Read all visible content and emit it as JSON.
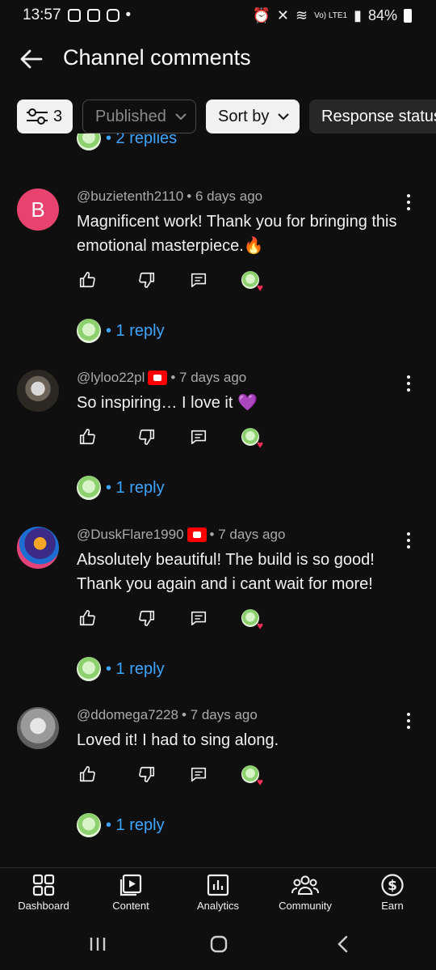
{
  "status_bar": {
    "time": "13:57",
    "signal": "Vo) LTE1",
    "battery": "84%"
  },
  "header": {
    "title": "Channel comments"
  },
  "filters": {
    "filter_count": "3",
    "published": "Published",
    "sort_by": "Sort by",
    "response_status": "Response status"
  },
  "top_partial_reply": {
    "label": "• 2 replies"
  },
  "comments": [
    {
      "avatar_letter": "B",
      "author": "@buzietenth2110",
      "time": "• 6 days ago",
      "text": "Magnificent work! Thank you for bringing this emotional masterpiece.🔥",
      "replies": "• 1 reply",
      "verified_badge": false
    },
    {
      "avatar_letter": "",
      "author": "@lyloo22pl",
      "time": "• 7 days ago",
      "text": "So inspiring… I love it 💜",
      "replies": "• 1 reply",
      "verified_badge": true
    },
    {
      "avatar_letter": "",
      "author": "@DuskFlare1990",
      "time": "• 7 days ago",
      "text": "Absolutely beautiful! The build is so good! Thank you again and i cant wait for more!",
      "replies": "• 1 reply",
      "verified_badge": true
    },
    {
      "avatar_letter": "",
      "author": "@ddomega7228",
      "time": "• 7 days ago",
      "text": "Loved it! I had to sing along.",
      "replies": "• 1 reply",
      "verified_badge": false
    }
  ],
  "bottom_nav": {
    "dashboard": "Dashboard",
    "content": "Content",
    "analytics": "Analytics",
    "community": "Community",
    "earn": "Earn"
  },
  "colors": {
    "background": "#0f0f0f",
    "accent_link": "#3ea6ff",
    "avatar_b": "#e8436e",
    "badge_red": "#ff0000"
  }
}
